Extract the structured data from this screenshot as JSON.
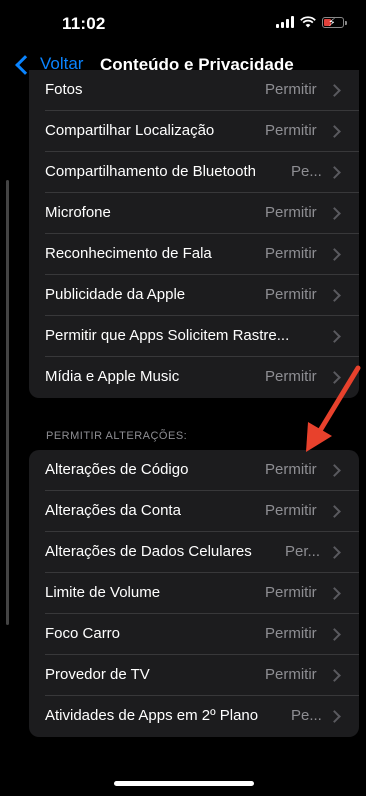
{
  "status_bar": {
    "time": "11:02"
  },
  "nav": {
    "back_label": "Voltar",
    "title": "Conteúdo e Privacidade"
  },
  "group_privacy": {
    "rows": [
      {
        "label": "Fotos",
        "value": "Permitir"
      },
      {
        "label": "Compartilhar Localização",
        "value": "Permitir"
      },
      {
        "label": "Compartilhamento de Bluetooth",
        "value": "Pe..."
      },
      {
        "label": "Microfone",
        "value": "Permitir"
      },
      {
        "label": "Reconhecimento de Fala",
        "value": "Permitir"
      },
      {
        "label": "Publicidade da Apple",
        "value": "Permitir"
      },
      {
        "label": "Permitir que Apps Solicitem Rastre...",
        "value": ""
      },
      {
        "label": "Mídia e Apple Music",
        "value": "Permitir"
      }
    ]
  },
  "section_header": "PERMITIR ALTERAÇÕES:",
  "group_changes": {
    "rows": [
      {
        "label": "Alterações de Código",
        "value": "Permitir"
      },
      {
        "label": "Alterações da Conta",
        "value": "Permitir"
      },
      {
        "label": "Alterações de Dados Celulares",
        "value": "Per..."
      },
      {
        "label": "Limite de Volume",
        "value": "Permitir"
      },
      {
        "label": "Foco Carro",
        "value": "Permitir"
      },
      {
        "label": "Provedor de TV",
        "value": "Permitir"
      },
      {
        "label": "Atividades de Apps em 2º Plano",
        "value": "Pe..."
      }
    ]
  },
  "colors": {
    "accent": "#0a84ff",
    "annotation_arrow": "#e8412c",
    "cell_background": "#1c1c1e"
  }
}
